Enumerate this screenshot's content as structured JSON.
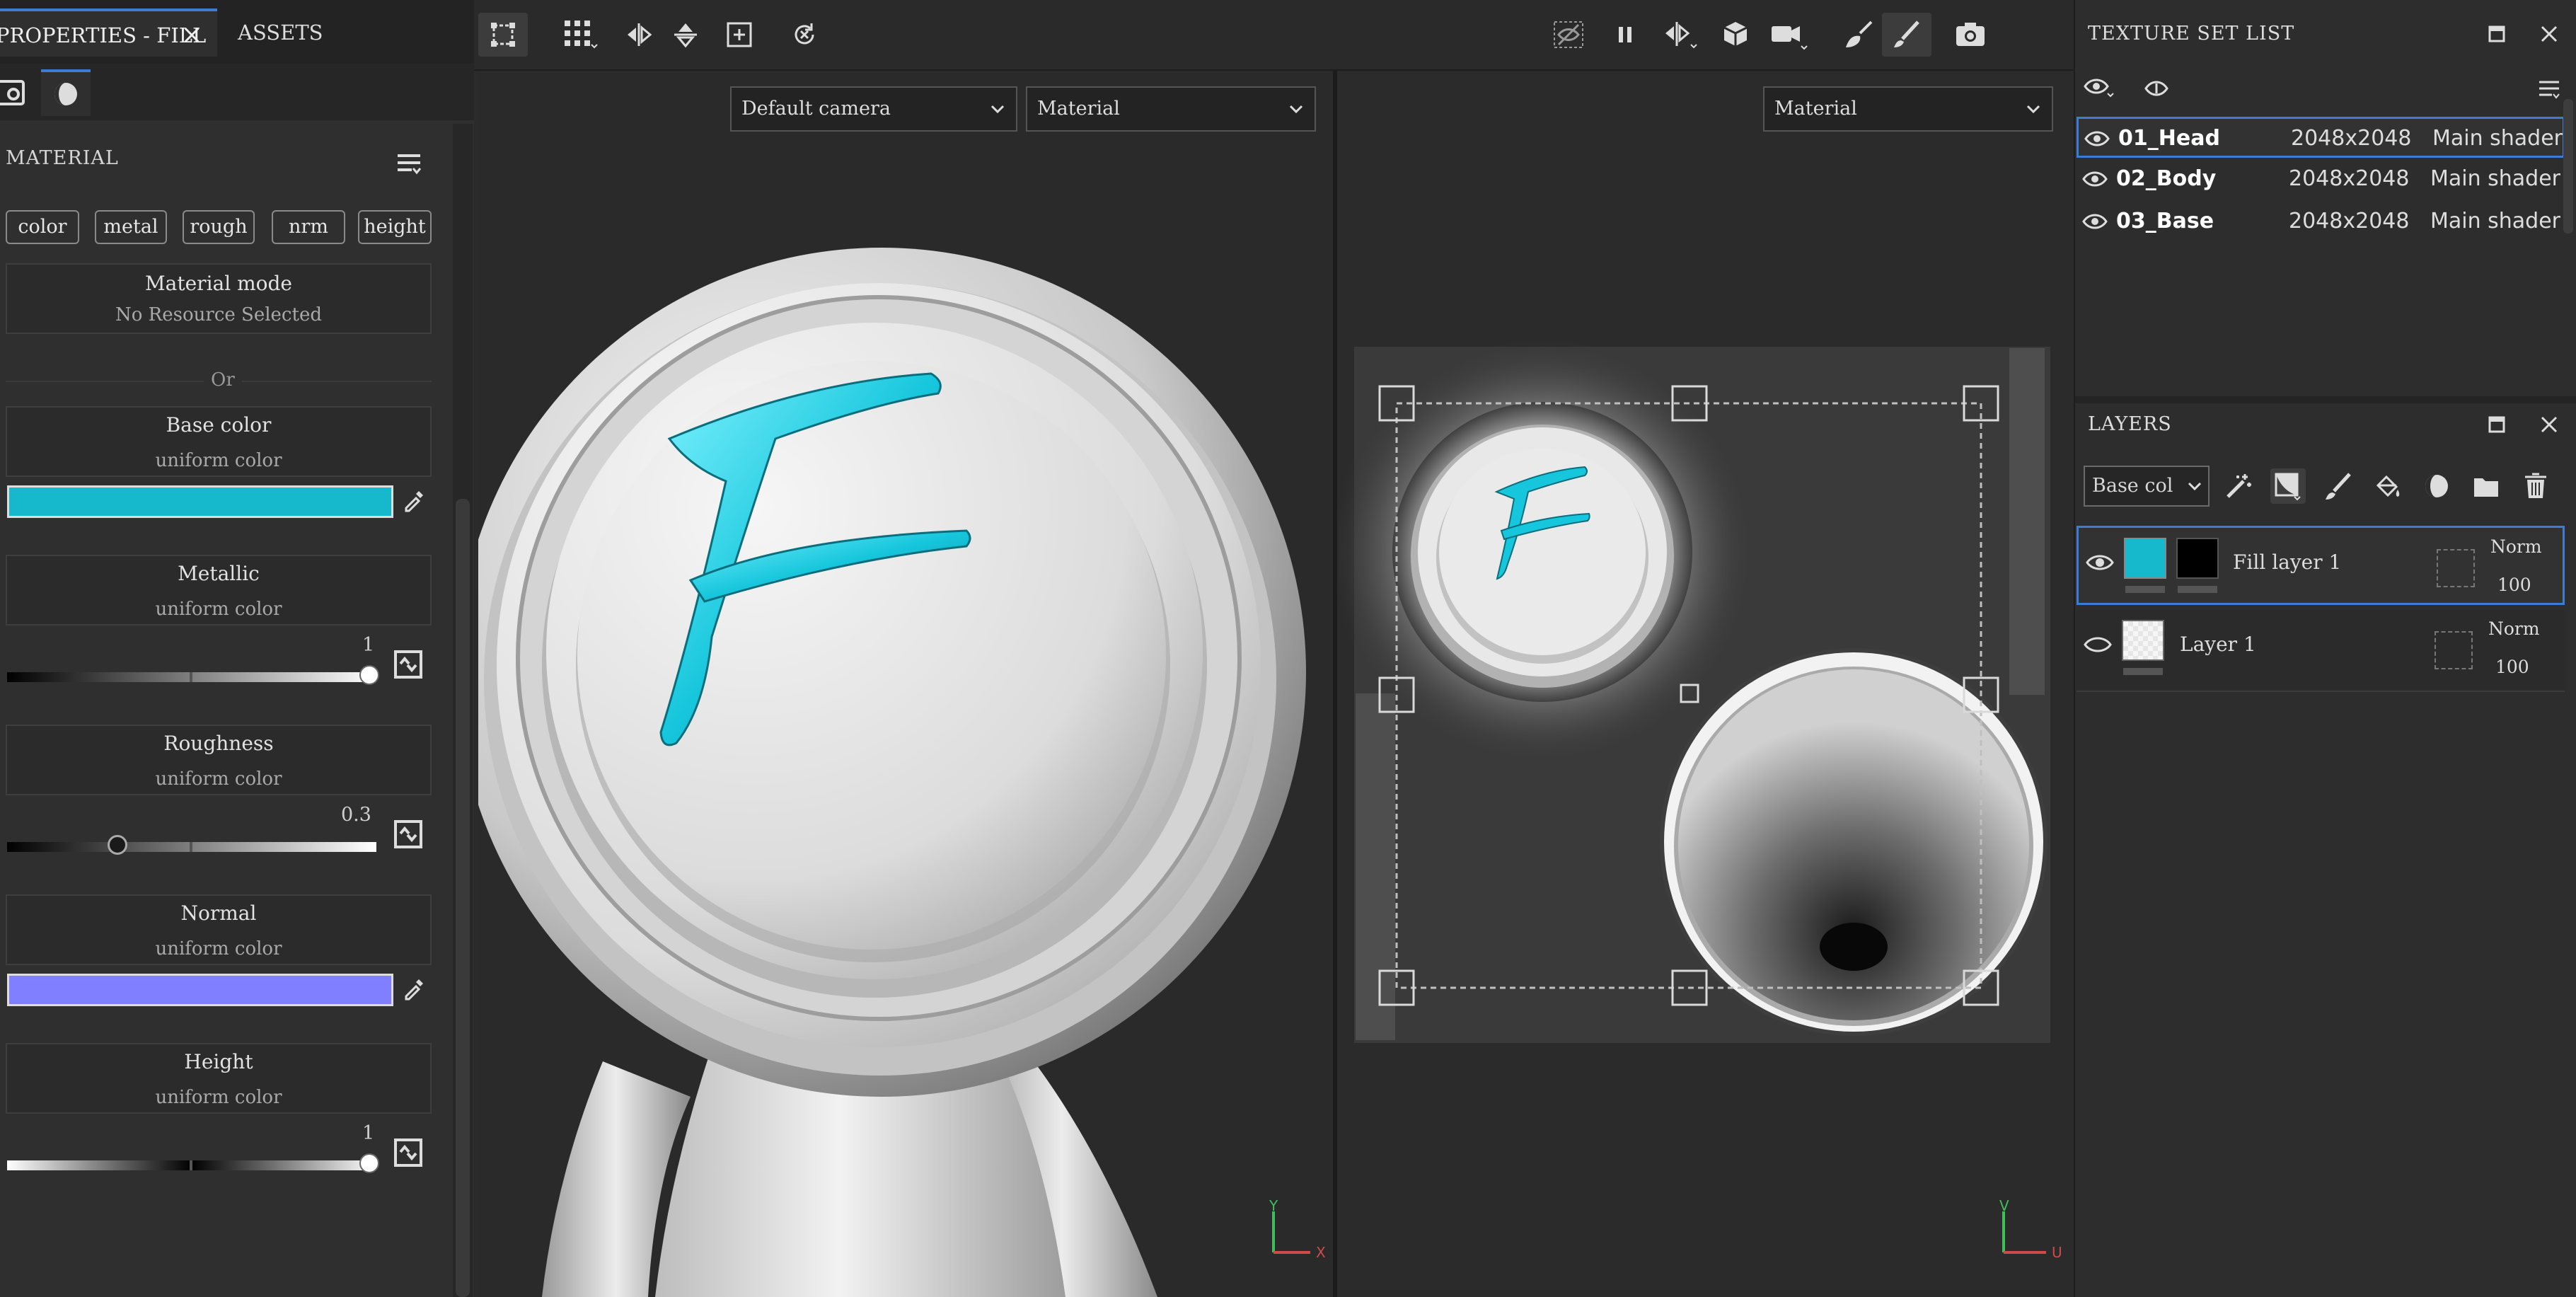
{
  "properties": {
    "tab_fill": "PROPERTIES - FILL",
    "tab_assets": "ASSETS",
    "section_title": "MATERIAL",
    "channels": [
      "color",
      "metal",
      "rough",
      "nrm",
      "height"
    ],
    "material_mode": {
      "title": "Material mode",
      "subtitle": "No Resource Selected"
    },
    "or_label": "Or",
    "base_color": {
      "title": "Base color",
      "subtitle": "uniform color",
      "color": "#16b9cc"
    },
    "metallic": {
      "title": "Metallic",
      "subtitle": "uniform color",
      "value": "1"
    },
    "roughness": {
      "title": "Roughness",
      "subtitle": "uniform color",
      "value": "0.3"
    },
    "normal": {
      "title": "Normal",
      "subtitle": "uniform color",
      "color": "#7f7fff"
    },
    "height": {
      "title": "Height",
      "subtitle": "uniform color",
      "value": "1"
    }
  },
  "viewport3d": {
    "camera": "Default camera",
    "mode": "Material",
    "axis_x": "X",
    "axis_y": "Y"
  },
  "viewport2d": {
    "mode": "Material",
    "axis_u": "U",
    "axis_v": "V"
  },
  "texture_set_list": {
    "title": "TEXTURE SET LIST",
    "rows": [
      {
        "name": "01_Head",
        "resolution": "2048x2048",
        "shader": "Main shader",
        "selected": true
      },
      {
        "name": "02_Body",
        "resolution": "2048x2048",
        "shader": "Main shader",
        "selected": false
      },
      {
        "name": "03_Base",
        "resolution": "2048x2048",
        "shader": "Main shader",
        "selected": false
      }
    ]
  },
  "layers": {
    "title": "LAYERS",
    "channel_select": "Base col",
    "rows": [
      {
        "name": "Fill layer 1",
        "blend": "Norm",
        "opacity": "100",
        "selected": true
      },
      {
        "name": "Layer 1",
        "blend": "Norm",
        "opacity": "100",
        "selected": false
      }
    ]
  },
  "colors": {
    "accent": "#3d7bd4",
    "cyan": "#16b9cc",
    "normal": "#7f7fff"
  }
}
